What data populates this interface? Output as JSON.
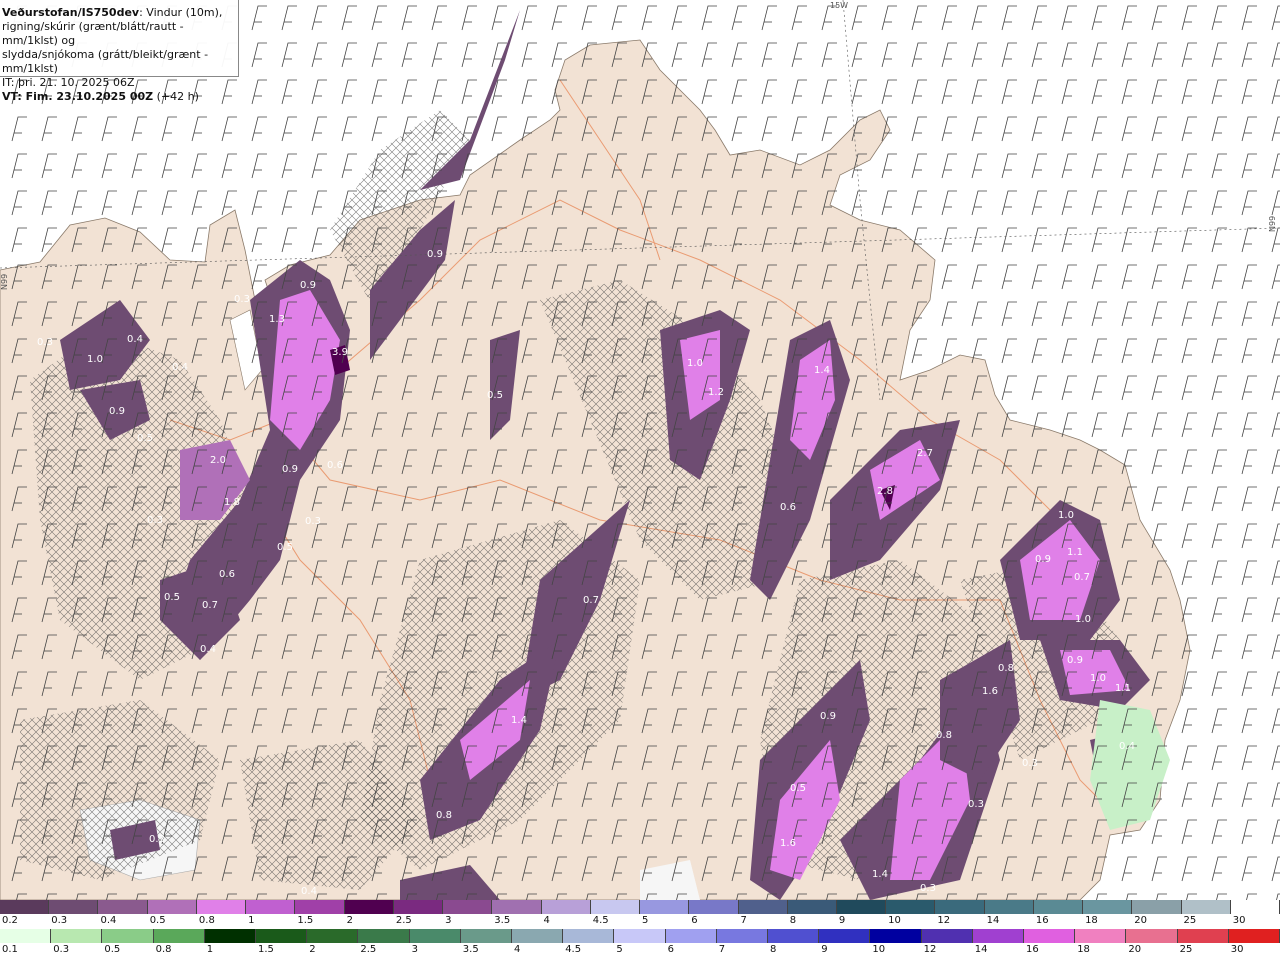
{
  "title": {
    "org": "Veðurstofan/IS750dev",
    "line1": ": Vindur (10m),",
    "line2": "rigning/skúrir (grænt/blátt/rautt - mm/1klst) og",
    "line3": "slydda/snjókoma (grátt/bleikt/grænt - mm/1klst)",
    "it": "IT: þri. 21. 10. 2025 06Z",
    "vt": "VT: Fim. 23.10.2025 00Z",
    "vt_offset": " (+42 h)"
  },
  "edge_labels": {
    "top": "15W",
    "left": "N99",
    "right": "N99"
  },
  "precip_labels": [
    "3.9",
    "2.0",
    "1.8",
    "1.0",
    "0.9",
    "0.5",
    "0.4",
    "0.3",
    "0.3",
    "0.9",
    "1.3",
    "0.9",
    "0.6",
    "0.9",
    "0.3",
    "0.5",
    "0.6",
    "0.5",
    "0.7",
    "0.4",
    "0.5",
    "1.0",
    "1.2",
    "1.4",
    "0.6",
    "2.7",
    "2.8",
    "0.7",
    "1.4",
    "0.3",
    "0.8",
    "0.5",
    "1.6",
    "1.4",
    "1.0",
    "0.9",
    "1.1",
    "0.7",
    "1.0",
    "0.8",
    "0.9",
    "1.0",
    "1.1",
    "1.6",
    "0.8",
    "0.9",
    "0.3",
    "0.4",
    "0.3",
    "0.3",
    "0.4",
    "0.3",
    "0.4"
  ],
  "legend_snow": {
    "ticks": [
      "0.2",
      "0.3",
      "0.4",
      "0.5",
      "0.8",
      "1",
      "1.5",
      "2",
      "2.5",
      "3",
      "3.5",
      "4",
      "4.5",
      "5",
      "6",
      "7",
      "8",
      "9",
      "10",
      "12",
      "14",
      "16",
      "18",
      "20",
      "25",
      "30"
    ],
    "colors": [
      "#5a3a5c",
      "#6e4c72",
      "#8a5a8e",
      "#b070b8",
      "#e080e8",
      "#c060d0",
      "#a040a8",
      "#500050",
      "#7a2a80",
      "#8a4a90",
      "#a070b0",
      "#b8a0d8",
      "#c8c8f0",
      "#9898e0",
      "#7878c8",
      "#50608c",
      "#3a5a78",
      "#204a5c",
      "#2a5a6c",
      "#3a6a7c",
      "#4a7a88",
      "#5a8a94",
      "#6a96a0",
      "#8aa0a8",
      "#b0c0c8",
      "#ffffff"
    ]
  },
  "legend_rain": {
    "ticks": [
      "0.1",
      "0.3",
      "0.5",
      "0.8",
      "1",
      "1.5",
      "2",
      "2.5",
      "3",
      "3.5",
      "4",
      "4.5",
      "5",
      "6",
      "7",
      "8",
      "9",
      "10",
      "12",
      "14",
      "16",
      "18",
      "20",
      "25",
      "30"
    ],
    "colors": [
      "#e6ffe6",
      "#b8e8b0",
      "#8acc88",
      "#5aa85a",
      "#003000",
      "#1a5a1a",
      "#2a6a2a",
      "#3a7a4a",
      "#4a8a6a",
      "#6a9a8a",
      "#8aa8b0",
      "#a8b8d8",
      "#c8c8f8",
      "#a0a0f0",
      "#7878e0",
      "#5050d0",
      "#3030c0",
      "#0000a0",
      "#5030b0",
      "#a040d0",
      "#e060e0",
      "#f080c0",
      "#e87090",
      "#e04050",
      "#e02020"
    ]
  }
}
